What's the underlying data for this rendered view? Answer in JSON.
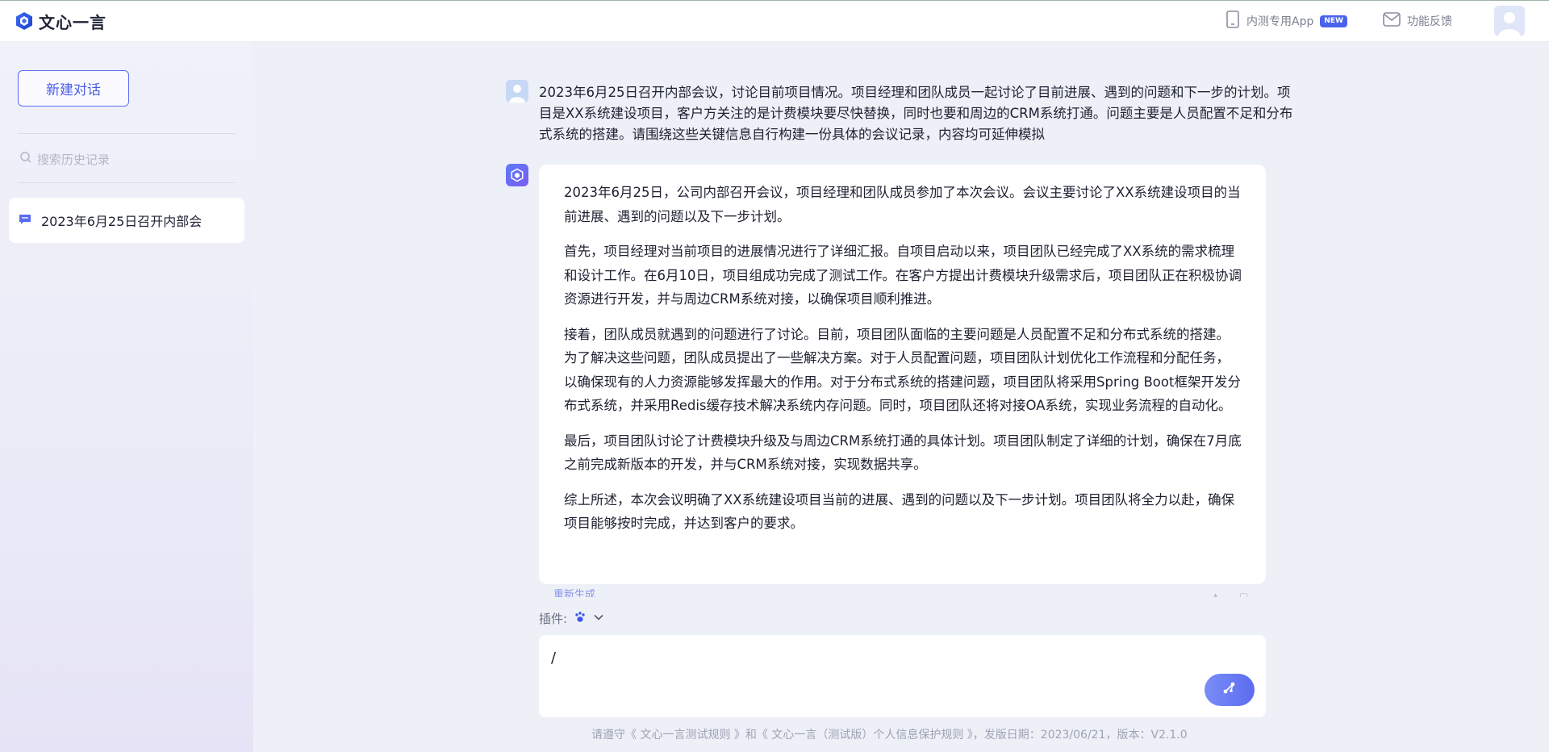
{
  "header": {
    "brand_name": "文心一言",
    "app_label": "内测专用App",
    "app_badge": "NEW",
    "feedback_label": "功能反馈"
  },
  "sidebar": {
    "new_chat_label": "新建对话",
    "search_placeholder": "搜索历史记录",
    "history": [
      {
        "label": "2023年6月25日召开内部会"
      }
    ]
  },
  "conversation": {
    "user_message": "2023年6月25日召开内部会议，讨论目前项目情况。项目经理和团队成员一起讨论了目前进展、遇到的问题和下一步的计划。项目是XX系统建设项目，客户方关注的是计费模块要尽快替换，同时也要和周边的CRM系统打通。问题主要是人员配置不足和分布式系统的搭建。请围绕这些关键信息自行构建一份具体的会议记录，内容均可延伸模拟",
    "bot_paragraphs": [
      "2023年6月25日，公司内部召开会议，项目经理和团队成员参加了本次会议。会议主要讨论了XX系统建设项目的当前进展、遇到的问题以及下一步计划。",
      "首先，项目经理对当前项目的进展情况进行了详细汇报。自项目启动以来，项目团队已经完成了XX系统的需求梳理和设计工作。在6月10日，项目组成功完成了测试工作。在客户方提出计费模块升级需求后，项目团队正在积极协调资源进行开发，并与周边CRM系统对接，以确保项目顺利推进。",
      "接着，团队成员就遇到的问题进行了讨论。目前，项目团队面临的主要问题是人员配置不足和分布式系统的搭建。为了解决这些问题，团队成员提出了一些解决方案。对于人员配置问题，项目团队计划优化工作流程和分配任务，以确保现有的人力资源能够发挥最大的作用。对于分布式系统的搭建问题，项目团队将采用Spring Boot框架开发分布式系统，并采用Redis缓存技术解决系统内存问题。同时，项目团队还将对接OA系统，实现业务流程的自动化。",
      "最后，项目团队讨论了计费模块升级及与周边CRM系统打通的具体计划。项目团队制定了详细的计划，确保在7月底之前完成新版本的开发，并与CRM系统对接，实现数据共享。",
      "综上所述，本次会议明确了XX系统建设项目当前的进展、遇到的问题以及下一步计划。项目团队将全力以赴，确保项目能够按时完成，并达到客户的要求。"
    ],
    "regenerate_label": "重新生成"
  },
  "composer": {
    "plugin_label": "插件:",
    "input_value": "/"
  },
  "footer": {
    "text": "请遵守《 文心一言测试规则 》和《 文心一言（测试版）个人信息保护规则 》，发版日期：2023/06/21，版本：V2.1.0"
  },
  "colors": {
    "accent": "#4a5ce8",
    "badge": "#4a63ea",
    "background": "#eef0f8"
  }
}
